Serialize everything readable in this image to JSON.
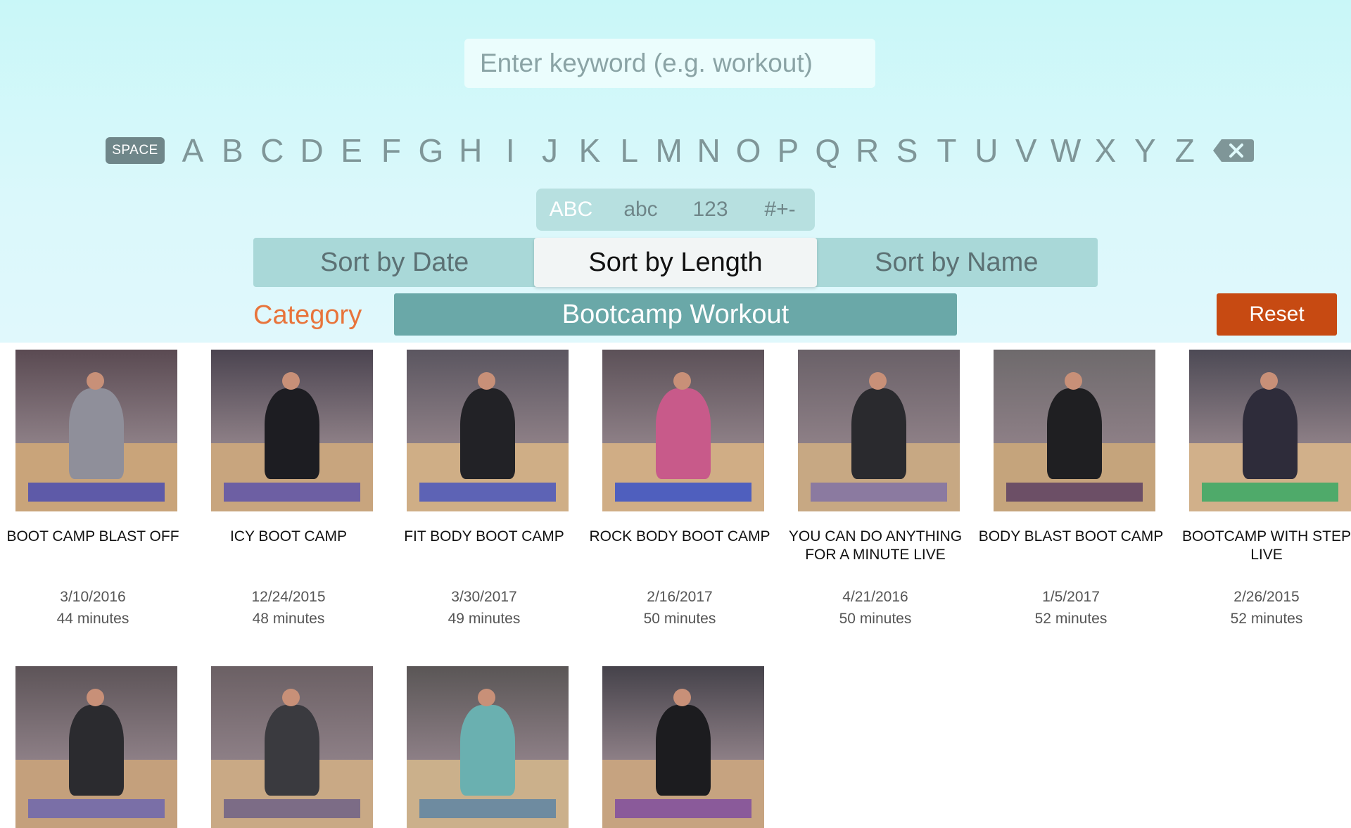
{
  "search": {
    "placeholder": "Enter keyword (e.g. workout)"
  },
  "keyboard": {
    "space_label": "SPACE",
    "letters": [
      "A",
      "B",
      "C",
      "D",
      "E",
      "F",
      "G",
      "H",
      "I",
      "J",
      "K",
      "L",
      "M",
      "N",
      "O",
      "P",
      "Q",
      "R",
      "S",
      "T",
      "U",
      "V",
      "W",
      "X",
      "Y",
      "Z"
    ],
    "delete_icon": "backspace-icon",
    "modes": [
      "ABC",
      "abc",
      "123",
      "#+-"
    ],
    "active_mode": "ABC"
  },
  "sort": {
    "options": [
      "Sort by Date",
      "Sort by Length",
      "Sort by Name"
    ],
    "active": "Sort by Length"
  },
  "category": {
    "label": "Category",
    "value": "Bootcamp Workout"
  },
  "reset_label": "Reset",
  "videos": [
    {
      "title": "BOOT CAMP BLAST OFF",
      "date": "3/10/2016",
      "length": "44 minutes"
    },
    {
      "title": "ICY BOOT CAMP",
      "date": "12/24/2015",
      "length": "48 minutes"
    },
    {
      "title": "FIT BODY BOOT CAMP",
      "date": "3/30/2017",
      "length": "49 minutes"
    },
    {
      "title": "ROCK BODY BOOT CAMP",
      "date": "2/16/2017",
      "length": "50 minutes"
    },
    {
      "title": "YOU CAN DO ANYTHING FOR A MINUTE LIVE",
      "date": "4/21/2016",
      "length": "50 minutes"
    },
    {
      "title": "BODY BLAST BOOT CAMP",
      "date": "1/5/2017",
      "length": "52 minutes"
    },
    {
      "title": "BOOTCAMP WITH STEP LIVE",
      "date": "2/26/2015",
      "length": "52 minutes"
    },
    {
      "title": "",
      "date": "",
      "length": ""
    },
    {
      "title": "",
      "date": "",
      "length": ""
    },
    {
      "title": "",
      "date": "",
      "length": ""
    },
    {
      "title": "",
      "date": "",
      "length": ""
    }
  ],
  "colors": {
    "accent_category": "#e8743b",
    "reset": "#c74a12",
    "category_bar": "#6aa8a8"
  }
}
